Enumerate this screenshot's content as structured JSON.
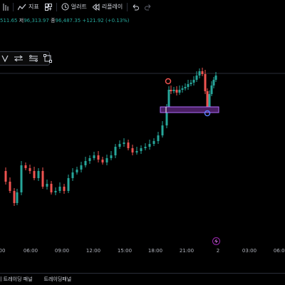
{
  "toolbar": {
    "indicator_label": "지표",
    "alert_label": "얼러트",
    "replay_label": "리플레이"
  },
  "ohlc": {
    "first": "511.65",
    "low_key": "저",
    "low_value": "96,313.97",
    "close_key": "종",
    "close_value": "96,487.35",
    "change": "+121.92 (+0.13%)"
  },
  "time_axis": {
    "labels": [
      "00",
      "06:00",
      "09:00",
      "12:00",
      "15:00",
      "18:00",
      "21:00",
      "2",
      "03:00",
      "06:00"
    ]
  },
  "bottom_tabs": [
    "이 트레이딩 패널",
    "트레이딩패널"
  ],
  "colors": {
    "up": "#26a69a",
    "down": "#ef5350",
    "zone_fill": "#4a1f63",
    "zone_border": "#b06cff",
    "marker_top": "#ef5350",
    "marker_bottom": "#5b7cfa",
    "accent": "#9c27b0"
  },
  "icons": {
    "drawbar": [
      "path-icon",
      "arrows-icon",
      "lines-icon",
      "frame-icon"
    ],
    "toolbar": [
      "compare-icon",
      "indicator-icon",
      "layout-icon",
      "alert-icon",
      "replay-icon",
      "undo-icon",
      "redo-icon"
    ]
  }
}
